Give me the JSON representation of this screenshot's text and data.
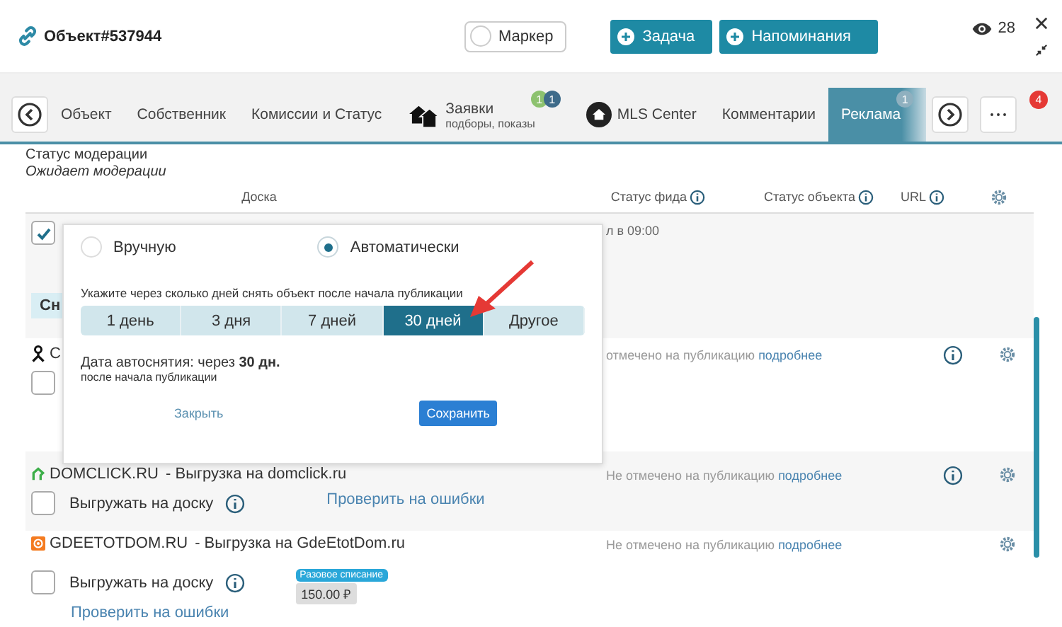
{
  "header": {
    "title": "Объект#537944",
    "marker": {
      "label": "Маркер",
      "checked": false
    },
    "buttons": [
      "Задача",
      "Напоминания"
    ],
    "views": "28"
  },
  "tabs": [
    {
      "label": "Объект",
      "kind": "plain",
      "selected": false
    },
    {
      "label": "Собственник",
      "kind": "plain",
      "selected": false
    },
    {
      "label": "Комиссии и Статус",
      "kind": "plain",
      "selected": false
    },
    {
      "label": "Заявки",
      "sublabel": "подборы, показы",
      "kind": "requests",
      "selected": false,
      "badges": [
        {
          "text": "1",
          "color": "#8dc26f"
        },
        {
          "text": "1",
          "color": "#3e6b8a"
        }
      ]
    },
    {
      "label": "MLS Center",
      "kind": "mls",
      "selected": false
    },
    {
      "label": "Комментарии",
      "kind": "plain",
      "selected": false
    },
    {
      "label": "Реклама",
      "kind": "plain",
      "selected": true,
      "badges": [
        {
          "text": "1",
          "color": "#8fb0bf"
        }
      ]
    }
  ],
  "more_badge": "4",
  "moderation": {
    "label": "Статус модерации",
    "value": "Ожидает модерации"
  },
  "columns": [
    {
      "label": "Доска"
    },
    {
      "label": "Статус фида"
    },
    {
      "label": "Статус объекта"
    },
    {
      "label": "URL"
    }
  ],
  "rows": [
    {
      "kind": "first",
      "checked": true,
      "feed": "л в 09:00",
      "button": "Сн",
      "url_info": false,
      "settings": false
    },
    {
      "kind": "board",
      "title": "С",
      "checked": false,
      "status": "отмечено на публикацию",
      "status_link": "подробнее",
      "url_info": true,
      "settings": true
    },
    {
      "kind": "board",
      "title": "DOMCLICK.RU",
      "subtitle": "- Выгрузка на domclick.ru",
      "checked": false,
      "upload_label": "Выгружать на доску",
      "check_link": "Проверить на ошибки",
      "status": "Не отмечено на публикацию",
      "status_link": "подробнее",
      "url_info": true,
      "settings": true
    },
    {
      "kind": "board",
      "title": "GDEETOTDOM.RU",
      "subtitle": "- Выгрузка на GdeEtotDom.ru",
      "checked": false,
      "upload_label": "Выгружать на доску",
      "price_tag": "Разовое списание",
      "price": "150.00 ₽",
      "check_link": "Проверить на ошибки",
      "status": "Не отмечено на публикацию",
      "status_link": "подробнее",
      "url_info": false,
      "settings": true
    }
  ],
  "popup": {
    "modes": [
      {
        "label": "Вручную",
        "selected": false
      },
      {
        "label": "Автоматически",
        "selected": true
      }
    ],
    "hint": "Укажите через сколько дней снять объект после начала публикации",
    "options": [
      {
        "label": "1 день",
        "selected": false
      },
      {
        "label": "3 дня",
        "selected": false
      },
      {
        "label": "7 дней",
        "selected": false
      },
      {
        "label": "30 дней",
        "selected": true
      },
      {
        "label": "Другое",
        "selected": false
      }
    ],
    "date_text": "Дата автоснятия: через **30 дн.**",
    "date_note": "после начала публикации",
    "close": "Закрыть",
    "save": "Сохранить"
  }
}
